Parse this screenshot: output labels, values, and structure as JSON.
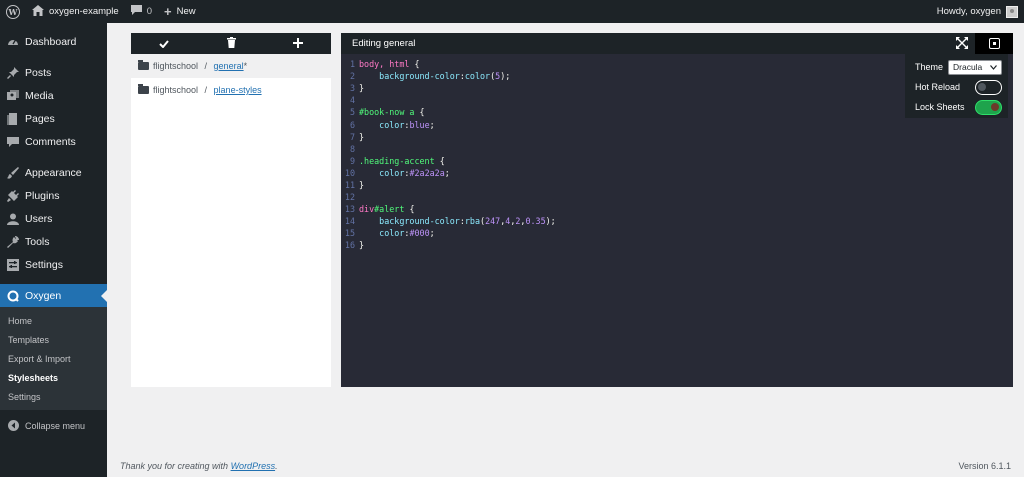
{
  "adminbar": {
    "site_name": "oxygen-example",
    "comments_count": "0",
    "new_label": "New",
    "howdy": "Howdy, oxygen"
  },
  "sidebar": {
    "items": [
      {
        "label": "Dashboard",
        "icon": "dashboard-icon"
      },
      {
        "label": "Posts",
        "icon": "pin-icon"
      },
      {
        "label": "Media",
        "icon": "media-icon"
      },
      {
        "label": "Pages",
        "icon": "page-icon"
      },
      {
        "label": "Comments",
        "icon": "comment-icon"
      },
      {
        "label": "Appearance",
        "icon": "brush-icon"
      },
      {
        "label": "Plugins",
        "icon": "plug-icon"
      },
      {
        "label": "Users",
        "icon": "user-icon"
      },
      {
        "label": "Tools",
        "icon": "wrench-icon"
      },
      {
        "label": "Settings",
        "icon": "sliders-icon"
      },
      {
        "label": "Oxygen",
        "icon": "oxygen-icon"
      }
    ],
    "submenu": [
      "Home",
      "Templates",
      "Export & Import",
      "Stylesheets",
      "Settings"
    ],
    "collapse": "Collapse menu"
  },
  "files": [
    {
      "folder": "flightschool",
      "sep": " / ",
      "name": "general",
      "modified": "*"
    },
    {
      "folder": "flightschool",
      "sep": " / ",
      "name": "plane-styles",
      "modified": ""
    }
  ],
  "editor": {
    "title": "Editing general",
    "lines": [
      {
        "n": "1",
        "parts": [
          {
            "t": "body, html ",
            "c": "#ff79c6"
          },
          {
            "t": "{",
            "c": "#f8f8f2"
          }
        ]
      },
      {
        "n": "2",
        "parts": [
          {
            "t": "    background-color",
            "c": "#8be9fd"
          },
          {
            "t": ":",
            "c": "#f8f8f2"
          },
          {
            "t": "color",
            "c": "#8be9fd"
          },
          {
            "t": "(",
            "c": "#f8f8f2"
          },
          {
            "t": "5",
            "c": "#bd93f9"
          },
          {
            "t": ");",
            "c": "#f8f8f2"
          }
        ]
      },
      {
        "n": "3",
        "parts": [
          {
            "t": "}",
            "c": "#f8f8f2"
          }
        ]
      },
      {
        "n": "4",
        "parts": []
      },
      {
        "n": "5",
        "parts": [
          {
            "t": "#book-now a ",
            "c": "#50fa7b"
          },
          {
            "t": "{",
            "c": "#f8f8f2"
          }
        ]
      },
      {
        "n": "6",
        "parts": [
          {
            "t": "    color",
            "c": "#8be9fd"
          },
          {
            "t": ":",
            "c": "#f8f8f2"
          },
          {
            "t": "blue",
            "c": "#bd93f9"
          },
          {
            "t": ";",
            "c": "#f8f8f2"
          }
        ]
      },
      {
        "n": "7",
        "parts": [
          {
            "t": "}",
            "c": "#f8f8f2"
          }
        ]
      },
      {
        "n": "8",
        "parts": []
      },
      {
        "n": "9",
        "parts": [
          {
            "t": ".heading-accent ",
            "c": "#50fa7b"
          },
          {
            "t": "{",
            "c": "#f8f8f2"
          }
        ]
      },
      {
        "n": "10",
        "parts": [
          {
            "t": "    color",
            "c": "#8be9fd"
          },
          {
            "t": ":",
            "c": "#f8f8f2"
          },
          {
            "t": "#2a2a2a",
            "c": "#bd93f9"
          },
          {
            "t": ";",
            "c": "#f8f8f2"
          }
        ]
      },
      {
        "n": "11",
        "parts": [
          {
            "t": "}",
            "c": "#f8f8f2"
          }
        ]
      },
      {
        "n": "12",
        "parts": []
      },
      {
        "n": "13",
        "parts": [
          {
            "t": "div",
            "c": "#ff79c6"
          },
          {
            "t": "#alert ",
            "c": "#50fa7b"
          },
          {
            "t": "{",
            "c": "#f8f8f2"
          }
        ]
      },
      {
        "n": "14",
        "parts": [
          {
            "t": "    background-color",
            "c": "#8be9fd"
          },
          {
            "t": ":",
            "c": "#f8f8f2"
          },
          {
            "t": "rba",
            "c": "#8be9fd"
          },
          {
            "t": "(",
            "c": "#f8f8f2"
          },
          {
            "t": "247",
            "c": "#bd93f9"
          },
          {
            "t": ",",
            "c": "#f8f8f2"
          },
          {
            "t": "4",
            "c": "#bd93f9"
          },
          {
            "t": ",",
            "c": "#f8f8f2"
          },
          {
            "t": "2",
            "c": "#bd93f9"
          },
          {
            "t": ",",
            "c": "#f8f8f2"
          },
          {
            "t": "0.35",
            "c": "#bd93f9"
          },
          {
            "t": ");",
            "c": "#f8f8f2"
          }
        ]
      },
      {
        "n": "15",
        "parts": [
          {
            "t": "    color",
            "c": "#8be9fd"
          },
          {
            "t": ":",
            "c": "#f8f8f2"
          },
          {
            "t": "#000",
            "c": "#bd93f9"
          },
          {
            "t": ";",
            "c": "#f8f8f2"
          }
        ]
      },
      {
        "n": "16",
        "parts": [
          {
            "t": "}",
            "c": "#f8f8f2"
          }
        ]
      }
    ]
  },
  "settings_panel": {
    "theme_label": "Theme",
    "theme_value": "Dracula",
    "hot_reload_label": "Hot Reload",
    "hot_reload_on": false,
    "lock_sheets_label": "Lock Sheets",
    "lock_sheets_on": true
  },
  "footer": {
    "thanks_prefix": "Thank you for creating with ",
    "wp_link": "WordPress",
    "thanks_suffix": ".",
    "version": "Version 6.1.1"
  },
  "colors": {
    "admin_dark": "#1d2327",
    "accent": "#2271b1",
    "editor_bg": "#282a36",
    "toggle_on": "#1ea34c"
  }
}
